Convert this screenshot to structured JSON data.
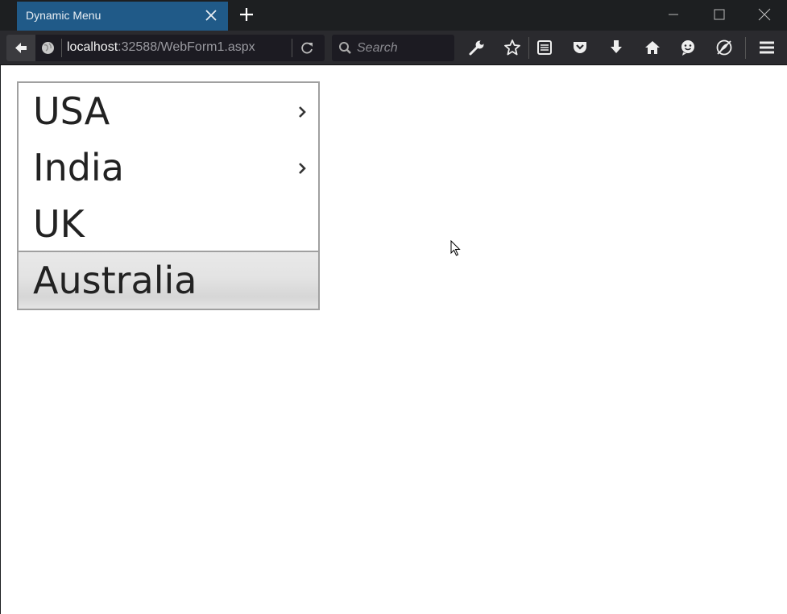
{
  "browser": {
    "tab_title": "Dynamic Menu",
    "url_host": "localhost",
    "url_rest": ":32588/WebForm1.aspx",
    "search_placeholder": "Search",
    "toolbar_icons": [
      "wrench-icon",
      "star-icon",
      "reader-icon",
      "pocket-icon",
      "download-icon",
      "home-icon",
      "smiley-icon",
      "tracking-icon",
      "hamburger-menu-icon"
    ]
  },
  "menu": {
    "items": [
      {
        "label": "USA",
        "has_submenu": true
      },
      {
        "label": "India",
        "has_submenu": true
      },
      {
        "label": "UK",
        "has_submenu": false
      },
      {
        "label": "Australia",
        "has_submenu": false,
        "hovered": true
      }
    ]
  },
  "colors": {
    "tab_active": "#205a88",
    "chrome_dark": "#1d1f21",
    "navbar": "#2a2a2e",
    "menu_border": "#a0a0a0",
    "hover_bg": "#e3e3e3"
  }
}
